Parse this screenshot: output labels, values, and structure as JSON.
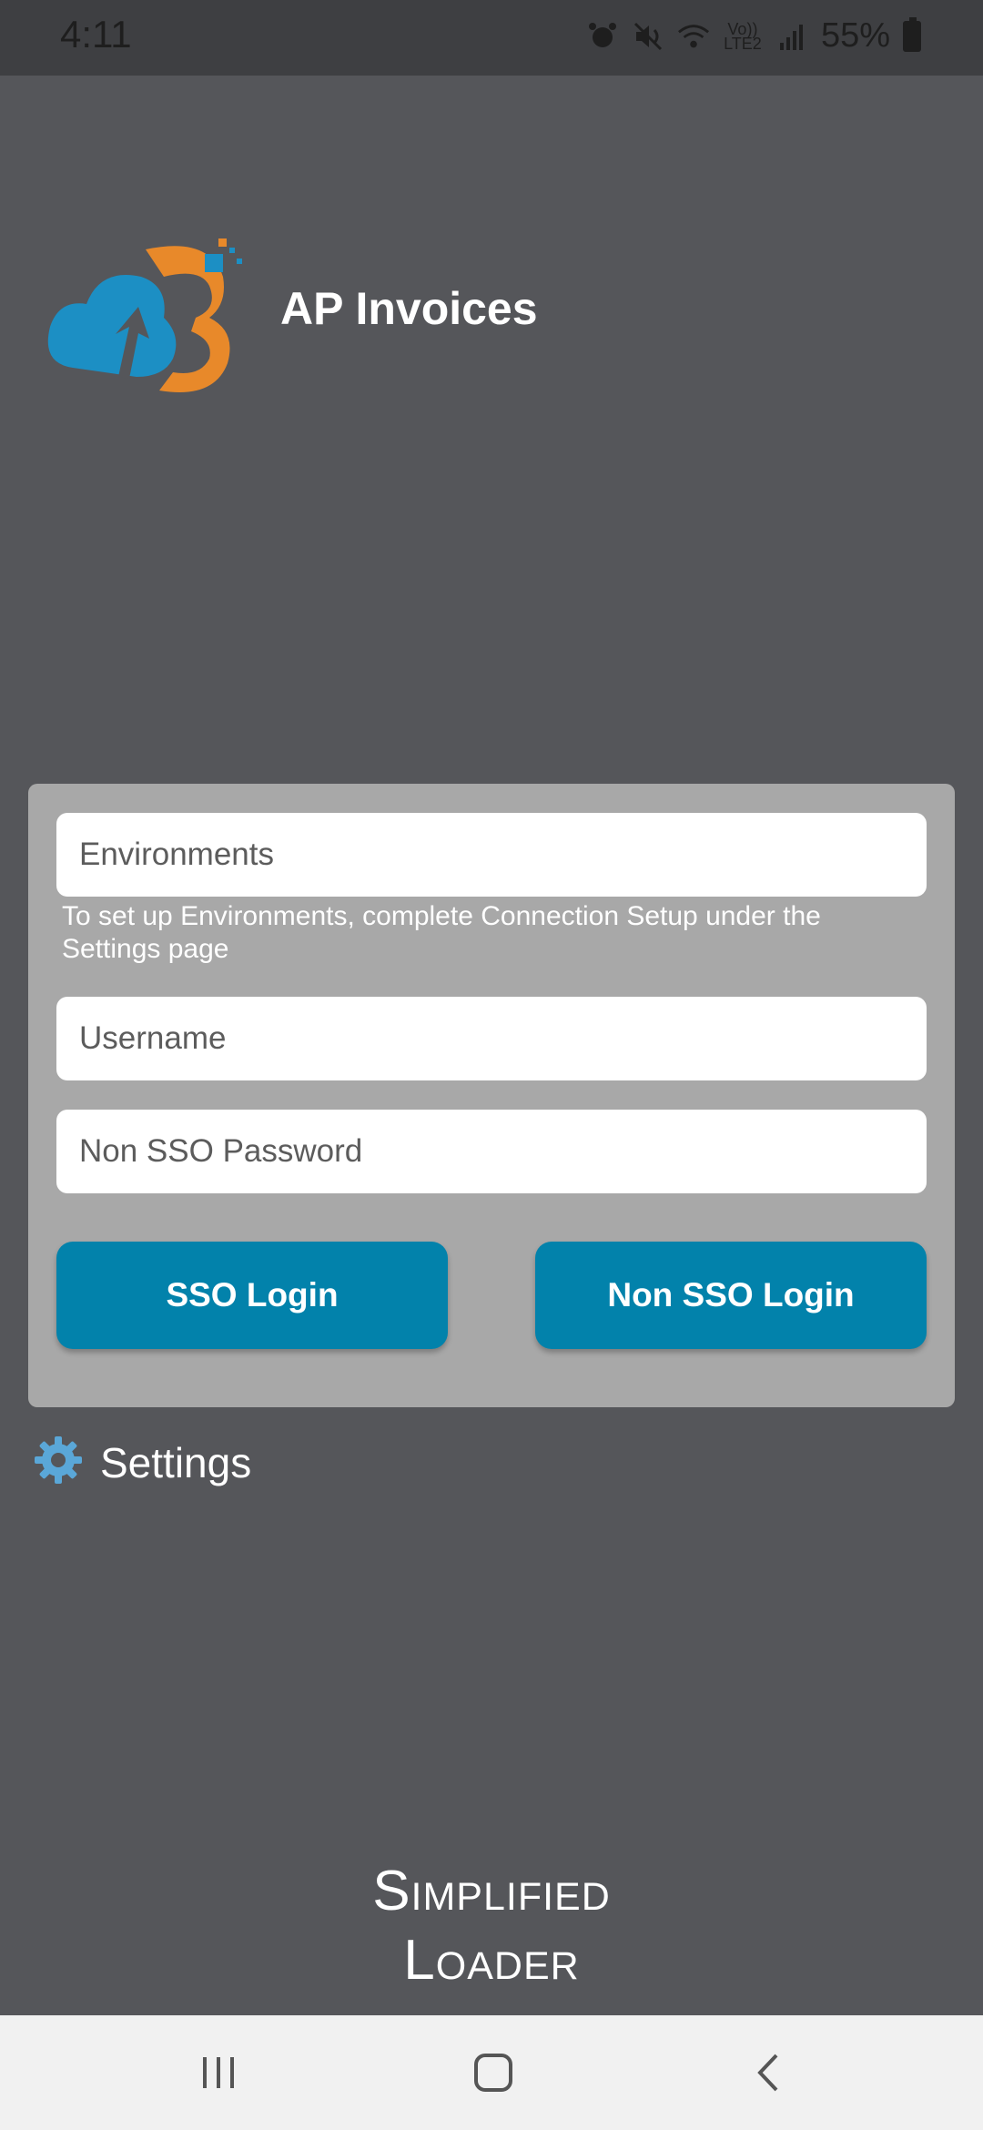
{
  "status_bar": {
    "time": "4:11",
    "network_label_top": "Vo))",
    "network_label_bottom": "LTE2",
    "battery": "55%"
  },
  "header": {
    "app_title": "AP Invoices"
  },
  "login": {
    "environments_placeholder": "Environments",
    "environments_hint": "To set up Environments, complete Connection Setup under the Settings page",
    "username_placeholder": "Username",
    "password_placeholder": "Non SSO Password",
    "sso_button": "SSO Login",
    "non_sso_button": "Non SSO Login"
  },
  "settings": {
    "label": "Settings"
  },
  "footer": {
    "brand_line1": "Simplified",
    "brand_line2": "Loader"
  },
  "colors": {
    "background": "#55565a",
    "card": "#a8a8a8",
    "button": "#0282ab",
    "logo_blue": "#1c8fc4",
    "logo_orange": "#e8892a"
  }
}
